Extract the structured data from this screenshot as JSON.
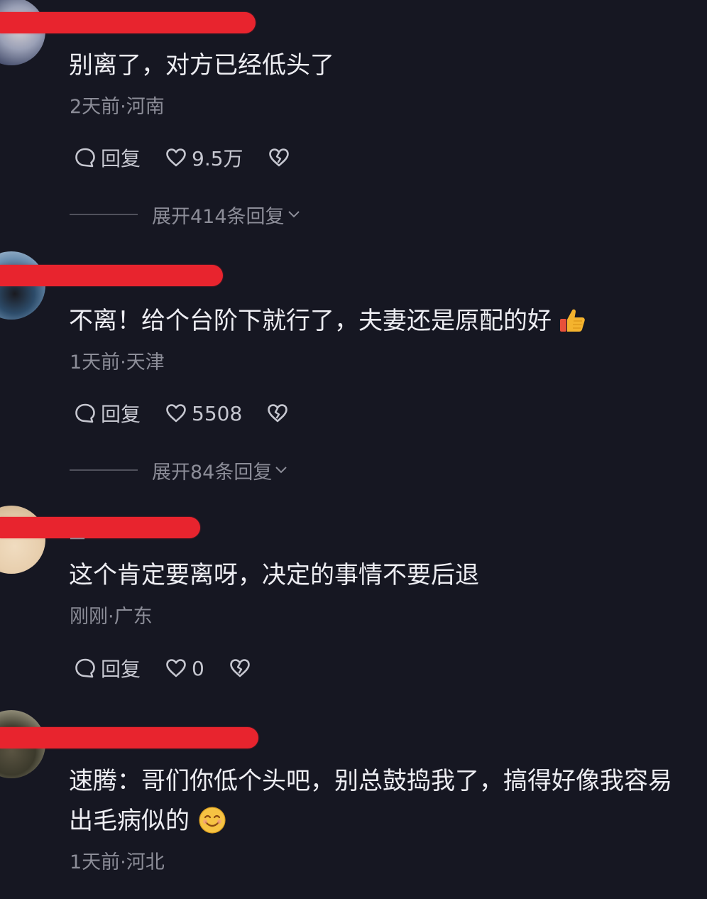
{
  "comments": [
    {
      "text": "别离了，对方已经低头了",
      "meta": "2天前·河南",
      "reply_label": "回复",
      "likes": "9.5万",
      "expand": "展开414条回复"
    },
    {
      "text": "不离！给个台阶下就行了，夫妻还是原配的好",
      "emoji": "thumbs-up",
      "meta": "1天前·天津",
      "reply_label": "回复",
      "likes": "5508",
      "expand": "展开84条回复"
    },
    {
      "username_visible": "一",
      "text": "这个肯定要离呀，决定的事情不要后退",
      "meta": "刚刚·广东",
      "reply_label": "回复",
      "likes": "0"
    },
    {
      "text_line1": "速腾：哥们你低个头吧，别总鼓捣我了，搞得好像我容易",
      "text_line2": "出毛病似的",
      "emoji": "smile",
      "meta": "1天前·河北"
    }
  ],
  "colors": {
    "background": "#161722",
    "redaction": "#e8242e",
    "text": "#ededf2",
    "meta": "#8c8d98"
  },
  "icons": [
    "comment-bubble-icon",
    "heart-icon",
    "broken-heart-icon",
    "chevron-down-icon"
  ]
}
